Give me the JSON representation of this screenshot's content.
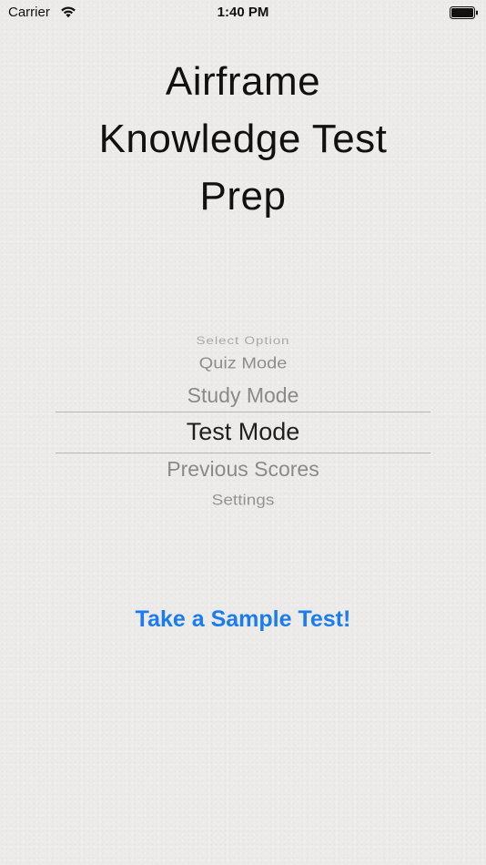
{
  "status_bar": {
    "carrier": "Carrier",
    "time": "1:40 PM",
    "icons": [
      "wifi-icon",
      "battery-icon"
    ]
  },
  "title": {
    "lines": [
      "Airframe",
      "Knowledge Test",
      "Prep"
    ]
  },
  "picker": {
    "options": [
      "Select Option",
      "Quiz Mode",
      "Study Mode",
      "Test Mode",
      "Previous Scores",
      "Settings"
    ],
    "selected": "Test Mode"
  },
  "sample_button": {
    "label": "Take a Sample Test!"
  },
  "colors": {
    "accent": "#1a7cf0",
    "background": "#ecebe9"
  }
}
